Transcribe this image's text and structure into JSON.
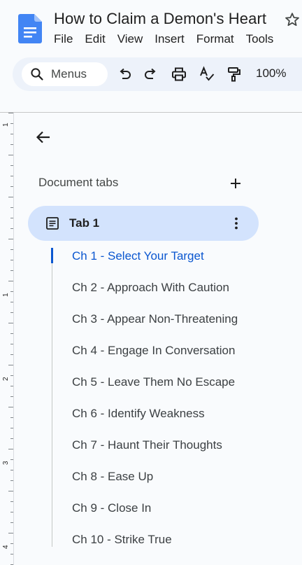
{
  "document": {
    "title": "How to Claim a Demon's Heart"
  },
  "menu": [
    "File",
    "Edit",
    "View",
    "Insert",
    "Format",
    "Tools"
  ],
  "toolbar": {
    "search_label": "Menus",
    "zoom": "100%"
  },
  "sidebar": {
    "section_title": "Document tabs",
    "tab": {
      "label": "Tab 1"
    },
    "chapters": [
      "Ch 1 - Select Your Target",
      "Ch 2 - Approach With Caution",
      "Ch 3 - Appear Non-Threatening",
      "Ch 4 - Engage In Conversation",
      "Ch 5 - Leave Them No Escape",
      "Ch 6 - Identify Weakness",
      "Ch 7 - Haunt Their Thoughts",
      "Ch 8 - Ease Up",
      "Ch 9 - Close In",
      "Ch 10 - Strike True"
    ],
    "active_chapter_index": 0
  },
  "ruler": {
    "labels": [
      "1",
      "1",
      "2",
      "3",
      "4"
    ]
  },
  "colors": {
    "accent": "#0b57d0",
    "tab_bg": "#d3e3fd",
    "toolbar_bg": "#edf2fa",
    "doc_blue": "#4285f4"
  }
}
